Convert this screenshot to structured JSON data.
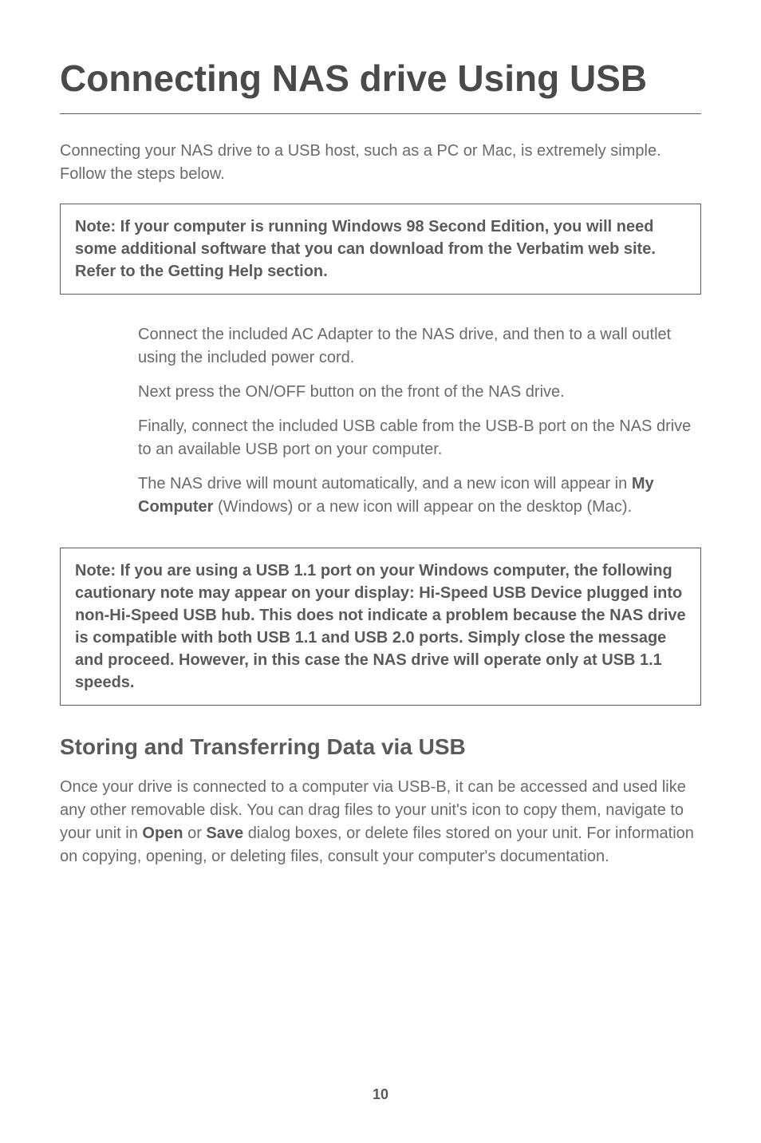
{
  "title": "Connecting NAS drive Using USB",
  "intro": "Connecting your NAS drive to a USB host, such as a PC or Mac, is extremely simple. Follow the steps below.",
  "note1": "Note: If your computer is running Windows 98 Second Edition, you will need some additional software that you can download from the Verbatim web site.  Refer to the Getting Help section.",
  "steps": {
    "s1": "Connect the included AC Adapter to the NAS drive, and then to a wall outlet using the included power cord.",
    "s2": "Next press the ON/OFF button on the front of the NAS drive.",
    "s3": "Finally, connect the included USB cable from the USB-B port on the NAS drive to an available USB port on your computer.",
    "s4a": "The NAS drive will mount automatically, and a new icon will appear in ",
    "s4bold": "My Computer",
    "s4b": " (Windows) or a new icon will appear on the desktop (Mac)."
  },
  "note2": "Note: If you are using a USB 1.1 port on your Windows computer, the following cautionary note may appear on your display: Hi-Speed USB Device plugged into non-Hi-Speed USB hub. This does not indicate a problem because the NAS drive is compatible with both USB 1.1 and USB 2.0 ports. Simply close the message and proceed. However, in this case the NAS drive will operate only at USB 1.1 speeds.",
  "section_heading": "Storing and Transferring Data via USB",
  "body": {
    "p1a": "Once your drive is connected to a computer via USB-B, it can be accessed and used like any other removable disk.  You can drag files to your unit's icon to copy them, navigate to your unit in ",
    "open": "Open",
    "p1b": " or ",
    "save": "Save",
    "p1c": " dialog boxes, or delete files stored on your unit.  For information on copying, opening, or deleting files, consult your computer's documentation."
  },
  "page_number": "10"
}
